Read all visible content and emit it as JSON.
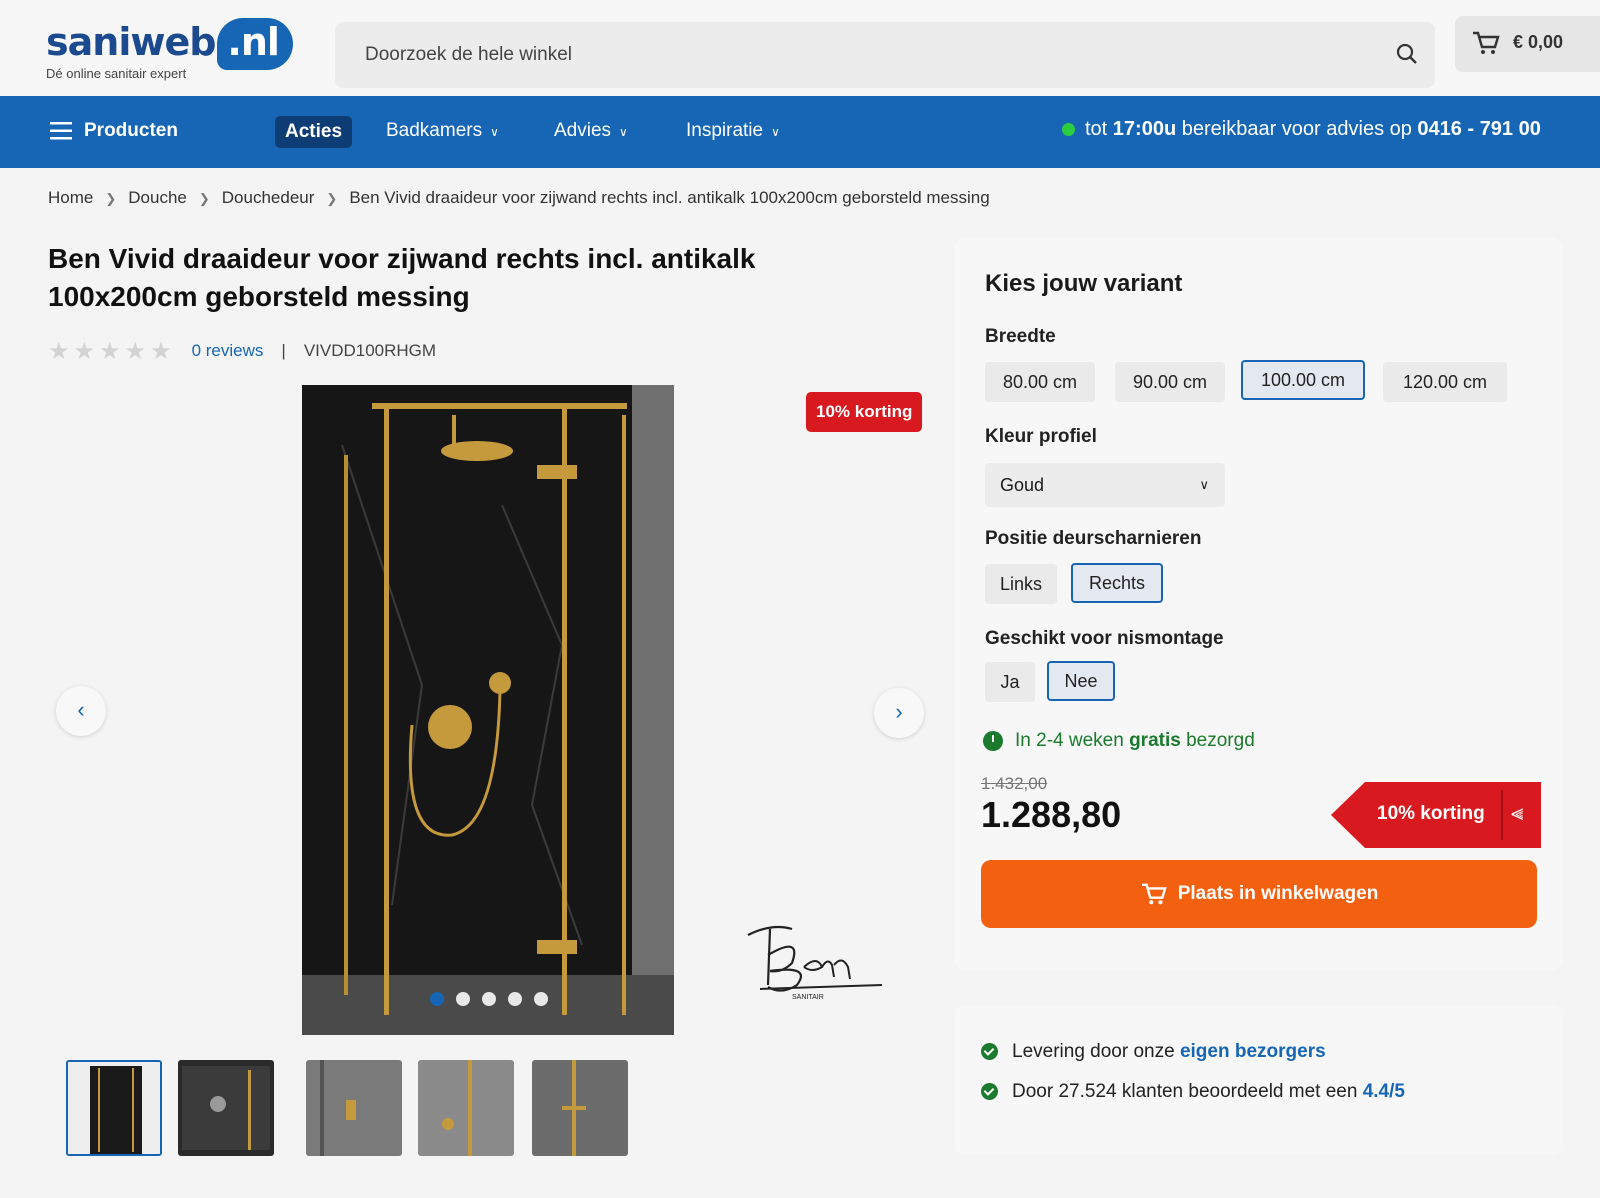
{
  "header": {
    "logo_text": "saniweb",
    "logo_domain": ".nl",
    "logo_tagline": "Dé online sanitair expert",
    "search_placeholder": "Doorzoek de hele winkel",
    "cart_total": "€ 0,00"
  },
  "nav": {
    "products": "Producten",
    "acties": "Acties",
    "badkamers": "Badkamers",
    "advies": "Advies",
    "inspiratie": "Inspiratie",
    "contact_prefix": "tot ",
    "contact_time": "17:00u",
    "contact_middle": " bereikbaar voor advies op ",
    "contact_phone": "0416 - 791 00"
  },
  "breadcrumb": [
    "Home",
    "Douche",
    "Douchedeur",
    "Ben Vivid draaideur voor zijwand rechts incl. antikalk 100x200cm geborsteld messing"
  ],
  "product": {
    "title": "Ben Vivid draaideur voor zijwand rechts incl. antikalk 100x200cm geborsteld messing",
    "rating_stars": 0,
    "reviews": "0 reviews",
    "sku": "VIVDD100RHGM",
    "discount_badge": "10% korting",
    "gallery_images": 5,
    "gallery_active": 1
  },
  "variant": {
    "title": "Kies jouw variant",
    "breedte_label": "Breedte",
    "breedte_options": [
      "80.00 cm",
      "90.00 cm",
      "100.00 cm",
      "120.00 cm"
    ],
    "breedte_selected": "100.00 cm",
    "kleur_label": "Kleur profiel",
    "kleur_value": "Goud",
    "positie_label": "Positie deurscharnieren",
    "positie_options": [
      "Links",
      "Rechts"
    ],
    "positie_selected": "Rechts",
    "nis_label": "Geschikt voor nismontage",
    "nis_options": [
      "Ja",
      "Nee"
    ],
    "nis_selected": "Nee",
    "delivery_prefix": "In 2-4 weken ",
    "delivery_bold": "gratis",
    "delivery_suffix": " bezorgd",
    "old_price": "1.432,00",
    "price": "1.288,80",
    "discount_flag": "10% korting",
    "cart_button": "Plaats in winkelwagen"
  },
  "usp": {
    "line1_prefix": "Levering door onze ",
    "line1_link": "eigen bezorgers",
    "line2_prefix": "Door 27.524 klanten beoordeeld met een ",
    "line2_score": "4.4/5"
  },
  "colors": {
    "brand_blue": "#1666b5",
    "discount_red": "#d81920",
    "cart_orange": "#f3600f",
    "delivery_green": "#1c7a2e"
  }
}
